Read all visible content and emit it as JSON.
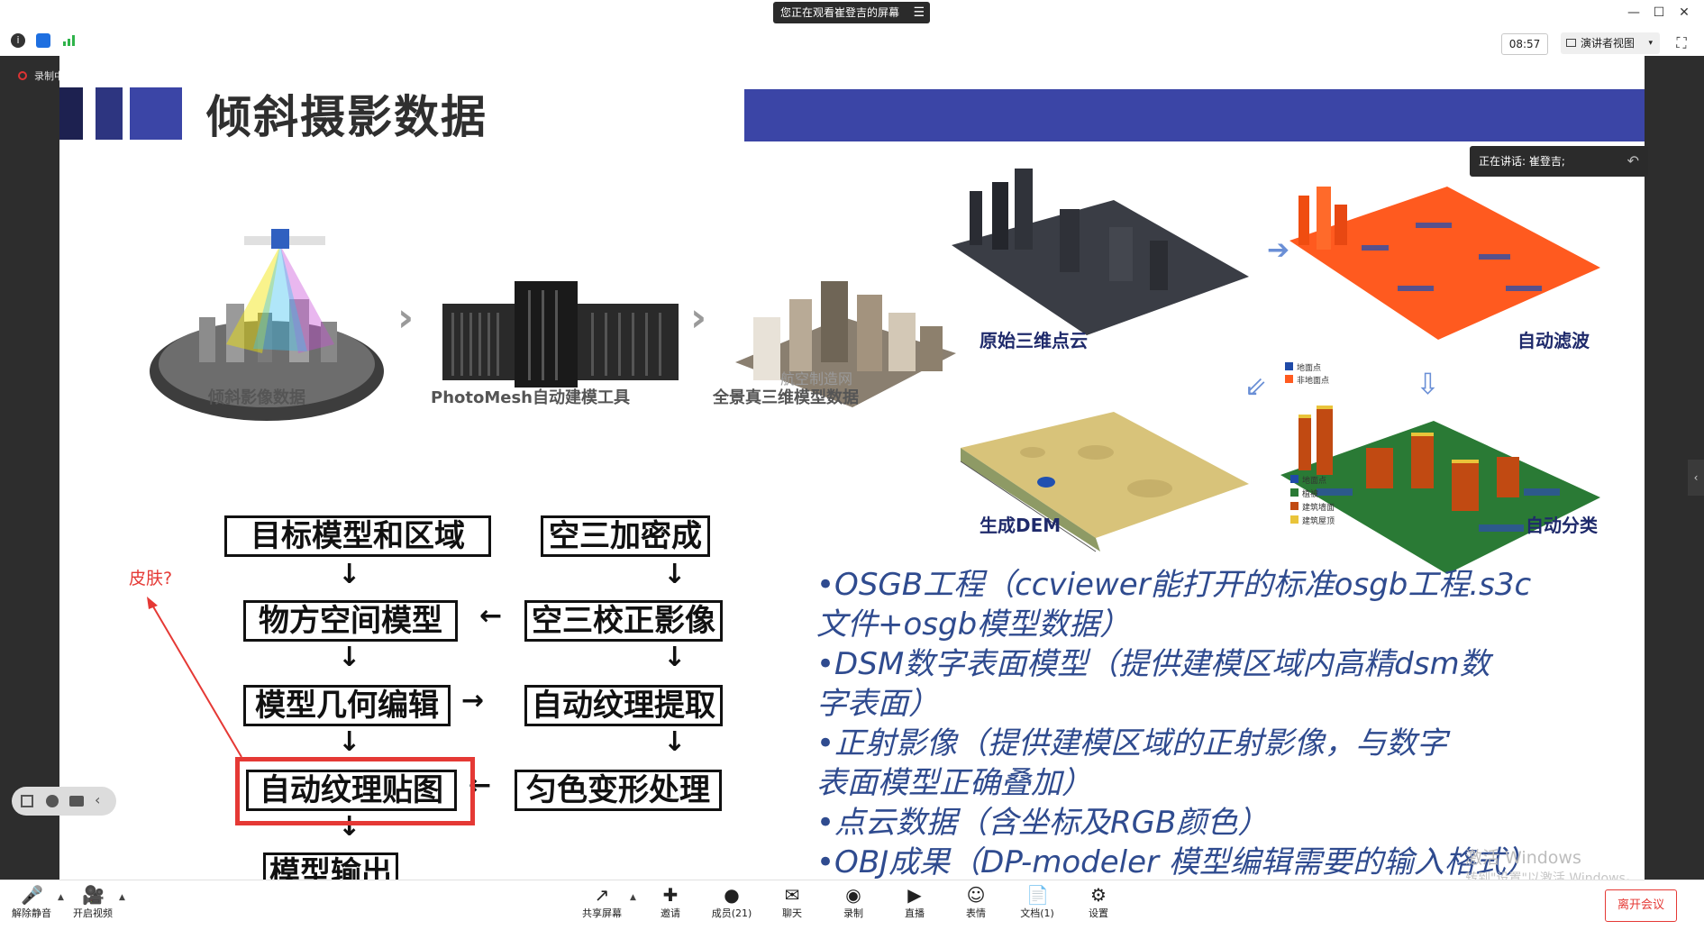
{
  "titlebar": {
    "share_banner": "您正在观看崔登吉的屏幕",
    "banner_menu": "☰",
    "min": "—",
    "max": "☐",
    "close": "✕"
  },
  "toolbar": {
    "clock": "08:57",
    "view_label": "演讲者视图",
    "caret": "▾",
    "fullscreen": "⛶"
  },
  "recording": {
    "label": "录制中"
  },
  "slide": {
    "title": "倾斜摄影数据",
    "captions": {
      "oblique": "倾斜影像数据",
      "photomesh": "PhotoMesh自动建模工具",
      "model": "全景真三维模型数据",
      "watermark_site": "航空制造网",
      "raw_cloud": "原始三维点云",
      "auto_filter": "自动滤波",
      "dem": "生成DEM",
      "auto_classify": "自动分类"
    },
    "legend_filter": [
      "地面点",
      "非地面点"
    ],
    "legend_classify": [
      "地面点",
      "植被",
      "建筑墙面",
      "建筑屋顶"
    ],
    "flow": {
      "b1": "目标模型和区域",
      "b2": "空三加密成",
      "b3": "物方空间模型",
      "b4": "空三校正影像",
      "b5": "模型几何编辑",
      "b6": "自动纹理提取",
      "b7": "自动纹理贴图",
      "b8": "匀色变形处理",
      "b9": "模型输出"
    },
    "annotation": "皮肤?",
    "bullets": [
      "•OSGB工程（ccviewer能打开的标准osgb工程.s3c",
      "文件+osgb模型数据）",
      "•DSM数字表面模型（提供建模区域内高精dsm数",
      "字表面）",
      "•正射影像（提供建模区域的正射影像，与数字",
      "表面模型正确叠加）",
      "•点云数据（含坐标及RGB颜色）",
      "•OBJ成果（DP-modeler 模型编辑需要的输入格式）"
    ],
    "windows_watermark": "激活 Windows",
    "windows_watermark_sub": "转到\"设置\"以激活 Windows。"
  },
  "speaker": {
    "label": "正在讲话: 崔登吉;",
    "back": "↶"
  },
  "bottombar": {
    "mute": "解除静音",
    "video": "开启视频",
    "share": "共享屏幕",
    "invite": "邀请",
    "members": "成员(21)",
    "chat": "聊天",
    "record": "录制",
    "live": "直播",
    "reaction": "表情",
    "docs": "文档(1)",
    "settings": "设置",
    "leave": "离开会议"
  },
  "colors": {
    "header_bar": "#3b45a6",
    "header_block_dark": "#1d2150",
    "highlight": "#e53935",
    "bullet_text": "#2f4b8f",
    "orange_cloud": "#ff5a1f"
  }
}
